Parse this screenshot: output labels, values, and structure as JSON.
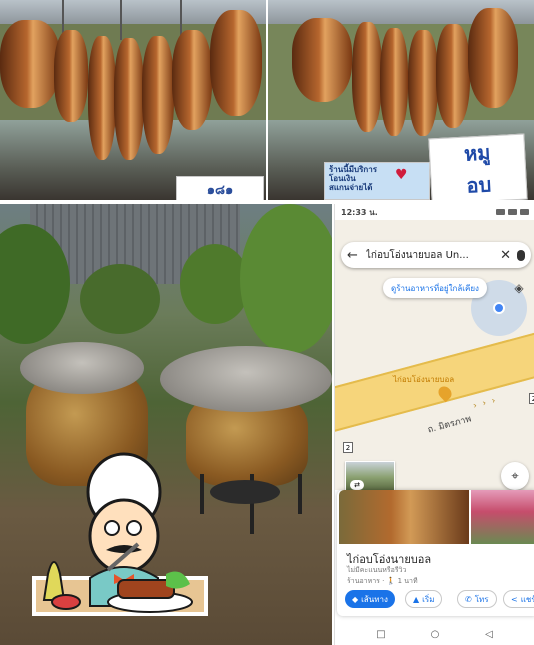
{
  "photos": {
    "top_left": {
      "price_sign": "๑๘๑"
    },
    "top_right": {
      "promo_sign": "ร้านนี้มีบริการ\nโอนเงิน\nสแกนจ่ายได้",
      "pork_sign": "หมู\nอบ"
    }
  },
  "phone": {
    "status": {
      "time": "12:33 น."
    },
    "search": {
      "text": "ไก่อบโอ่งนายบอล Un..."
    },
    "nearby_chip": "ดูร้านอาหารที่อยู่ใกล้เคียง",
    "map": {
      "pin_label": "ไก่อบโอ่งนายบอล",
      "road_label": "ถ. มิตรภาพ",
      "route_shield_left": "2",
      "route_shield_right": "2"
    },
    "place": {
      "name": "ไก่อบโอ่งนายบอล",
      "reviews": "ไม่มีคะแนนหรือรีวิว",
      "category": "ร้านอาหาร",
      "walk_time": "1 นาที"
    },
    "actions": {
      "directions": "เส้นทาง",
      "start": "เริ่ม",
      "call": "โทร",
      "share": "แชร์"
    }
  },
  "icons": {
    "back": "arrow-left-icon",
    "clear": "close-icon",
    "mic": "microphone-icon",
    "layers": "layers-icon",
    "recenter": "my-location-icon",
    "directions": "directions-icon",
    "start": "navigation-arrow-icon",
    "call": "phone-icon",
    "share": "share-icon"
  },
  "colors": {
    "accent_blue": "#1a73e8",
    "road_yellow": "#f6d57b",
    "pin_orange": "#e6a32b"
  }
}
